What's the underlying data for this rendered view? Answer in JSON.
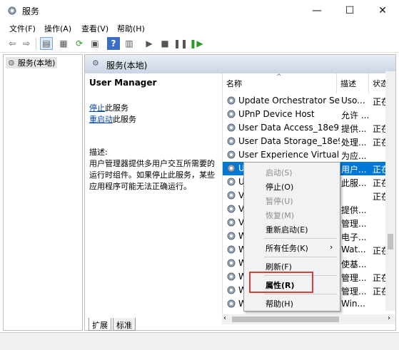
{
  "window": {
    "title": "服务",
    "minimize": "—",
    "maximize": "☐",
    "close": "✕"
  },
  "menu": [
    "文件(F)",
    "操作(A)",
    "查看(V)",
    "帮助(H)"
  ],
  "tree": {
    "root": "服务(本地)"
  },
  "panel": {
    "title": "服务(本地)"
  },
  "detail": {
    "service_name": "User Manager",
    "stop_link": "停止",
    "stop_suffix": "此服务",
    "restart_link": "重启动",
    "restart_suffix": "此服务",
    "desc_label": "描述:",
    "desc_line1": "用户管理器提供多用户交互所需要的",
    "desc_line2": "运行时组件。如果停止此服务，某些",
    "desc_line3": "应用程序可能无法正确运行。"
  },
  "columns": {
    "name": "名称",
    "desc": "描述",
    "status": "状态"
  },
  "rows": [
    {
      "name": "Update Orchestrator Ser...",
      "desc": "Uso...",
      "status": "正在"
    },
    {
      "name": "UPnP Device Host",
      "desc": "允许 ...",
      "status": ""
    },
    {
      "name": "User Data Access_18e99aa",
      "desc": "提供...",
      "status": "正在"
    },
    {
      "name": "User Data Storage_18e9...",
      "desc": "处理...",
      "status": "正在"
    },
    {
      "name": "User Experience Virtualiz...",
      "desc": "为应...",
      "status": ""
    },
    {
      "name": "User Manager",
      "desc": "用户...",
      "status": "正在"
    },
    {
      "name": "U",
      "desc": "此服...",
      "status": "正在"
    },
    {
      "name": "Vi",
      "desc": "",
      "status": "正在"
    },
    {
      "name": "Vi",
      "desc": "提供...",
      "status": ""
    },
    {
      "name": "Vo",
      "desc": "管理...",
      "status": ""
    },
    {
      "name": "W",
      "desc": "电子...",
      "status": ""
    },
    {
      "name": "W",
      "desc": "Wat...",
      "status": "正在"
    },
    {
      "name": "W",
      "desc": "使基...",
      "status": ""
    },
    {
      "name": "W",
      "desc": "管理...",
      "status": "正在"
    },
    {
      "name": "W",
      "desc": "管理...",
      "status": "正在"
    },
    {
      "name": "W",
      "desc": "Win...",
      "status": ""
    }
  ],
  "context_menu": {
    "start": "启动(S)",
    "stop": "停止(O)",
    "pause": "暂停(U)",
    "resume": "恢复(M)",
    "restart": "重新启动(E)",
    "all_tasks": "所有任务(K)",
    "refresh": "刷新(F)",
    "properties": "属性(R)",
    "help": "帮助(H)"
  },
  "tabs": [
    "扩展",
    "标准"
  ],
  "colors": {
    "selection": "#0078d7",
    "highlight_box": "#d3413a",
    "link": "#0645ad"
  }
}
